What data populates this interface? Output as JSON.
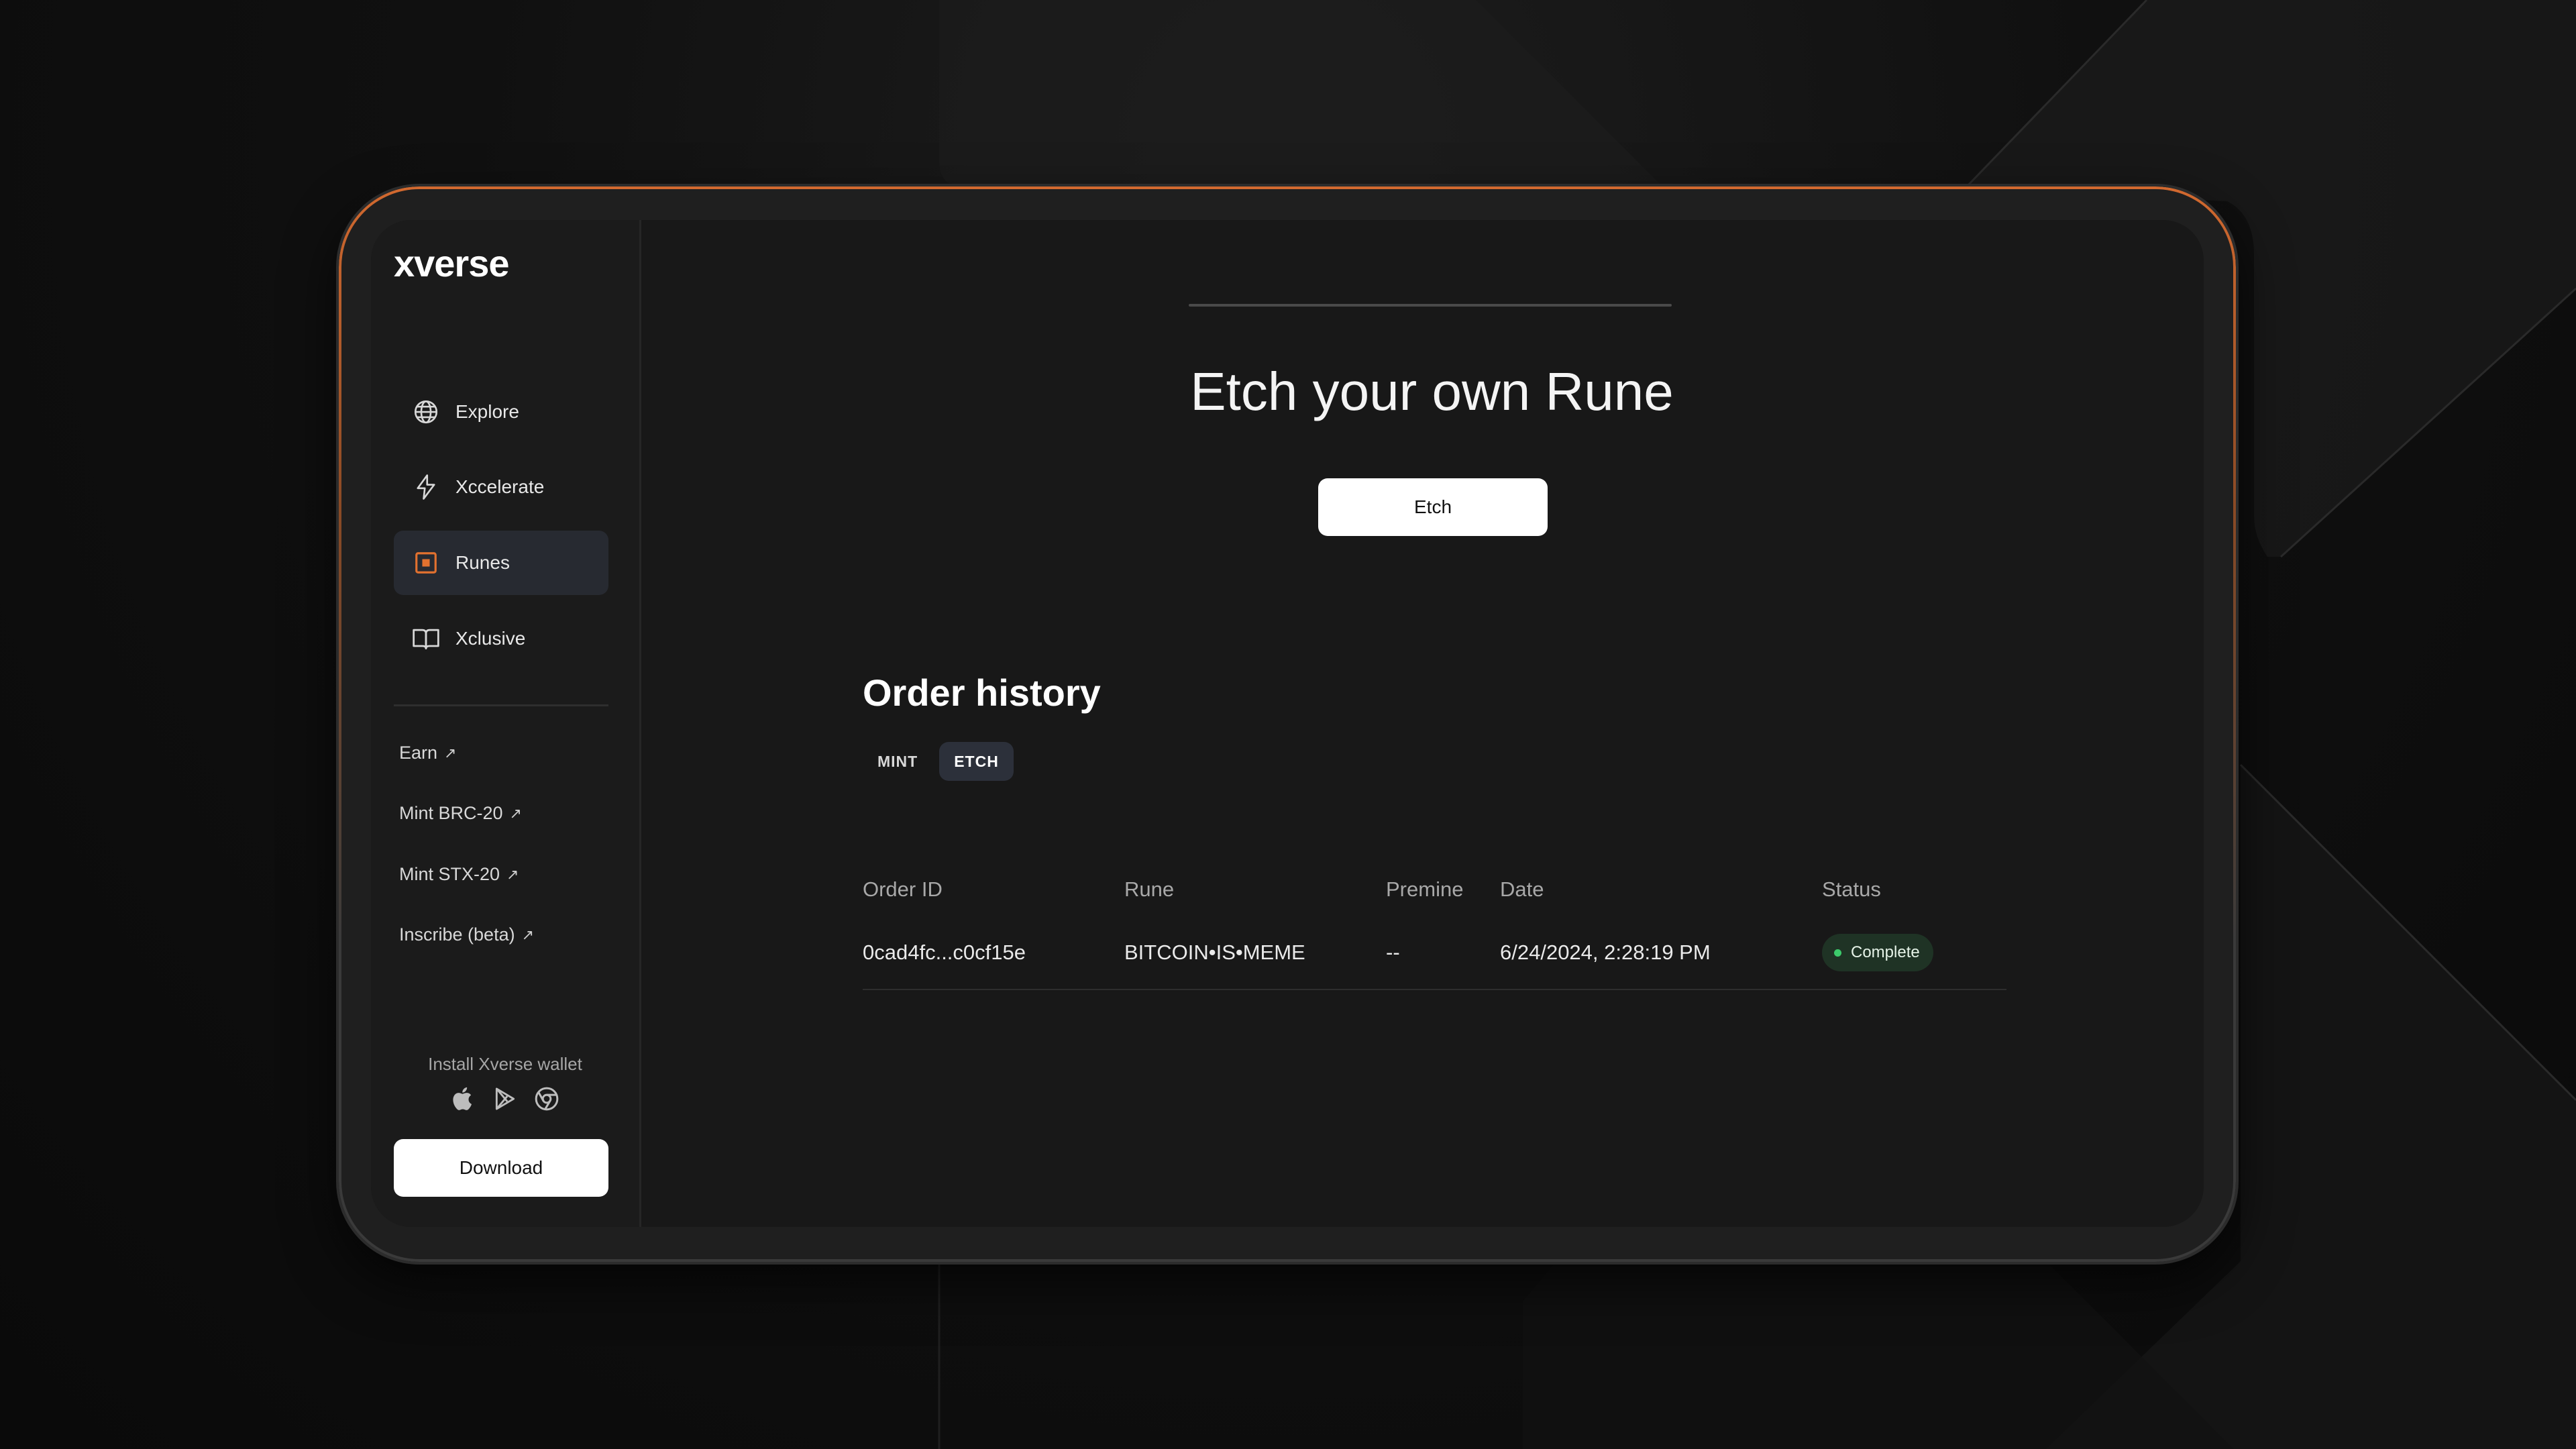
{
  "brand": {
    "logo_text": "xverse"
  },
  "sidebar": {
    "nav": [
      {
        "label": "Explore",
        "icon": "globe-icon"
      },
      {
        "label": "Xccelerate",
        "icon": "lightning-icon"
      },
      {
        "label": "Runes",
        "icon": "runes-icon",
        "active": true
      },
      {
        "label": "Xclusive",
        "icon": "book-icon"
      }
    ],
    "links": [
      {
        "label": "Earn"
      },
      {
        "label": "Mint BRC-20"
      },
      {
        "label": "Mint STX-20"
      },
      {
        "label": "Inscribe (beta)"
      }
    ],
    "link_arrow": "↗",
    "install_label": "Install Xverse wallet",
    "stores": [
      "apple-icon",
      "google-play-icon",
      "chrome-icon"
    ],
    "download_label": "Download"
  },
  "main": {
    "hero_title": "Etch your own Rune",
    "etch_label": "Etch",
    "order_history": {
      "title": "Order history",
      "tabs": [
        {
          "label": "MINT"
        },
        {
          "label": "ETCH",
          "active": true
        }
      ],
      "columns": [
        "Order ID",
        "Rune",
        "Premine",
        "Date",
        "Status"
      ],
      "rows": [
        {
          "order_id": "0cad4fc...c0cf15e",
          "rune": "BITCOIN•IS•MEME",
          "premine": "--",
          "date": "6/24/2024, 2:28:19 PM",
          "status": "Complete"
        }
      ]
    }
  },
  "colors": {
    "accent": "#e2712f",
    "status_complete": "#3ccb6b",
    "active_nav_bg": "#272a31"
  }
}
